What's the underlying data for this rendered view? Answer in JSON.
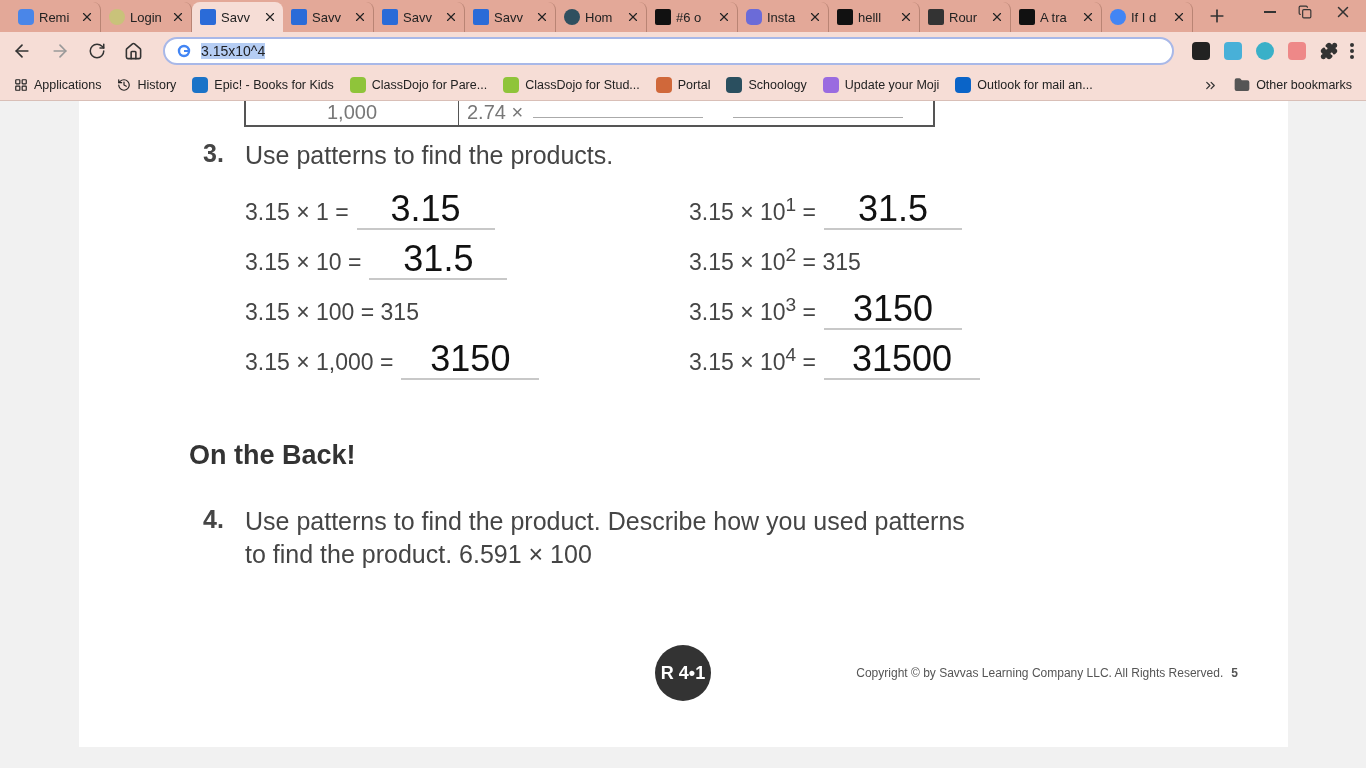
{
  "tabs": [
    {
      "label": "Remi",
      "selected": false
    },
    {
      "label": "Login",
      "selected": false
    },
    {
      "label": "Savv",
      "selected": true
    },
    {
      "label": "Savv",
      "selected": false
    },
    {
      "label": "Savv",
      "selected": false
    },
    {
      "label": "Savv",
      "selected": false
    },
    {
      "label": "Hom",
      "selected": false
    },
    {
      "label": "#6 o",
      "selected": false
    },
    {
      "label": "Insta",
      "selected": false
    },
    {
      "label": "helll",
      "selected": false
    },
    {
      "label": "Rour",
      "selected": false
    },
    {
      "label": "A tra",
      "selected": false
    },
    {
      "label": "If I d",
      "selected": false
    }
  ],
  "address_bar": {
    "value": "3.15x10^4"
  },
  "bookmarks": [
    {
      "label": "Applications",
      "kind": "apps"
    },
    {
      "label": "History",
      "kind": "history"
    },
    {
      "label": "Epic! - Books for Kids",
      "kind": "site"
    },
    {
      "label": "ClassDojo for Pare...",
      "kind": "site"
    },
    {
      "label": "ClassDojo for Stud...",
      "kind": "site"
    },
    {
      "label": "Portal",
      "kind": "site"
    },
    {
      "label": "Schoology",
      "kind": "site"
    },
    {
      "label": "Update your Moji",
      "kind": "site"
    },
    {
      "label": "Outlook for mail an...",
      "kind": "site"
    }
  ],
  "other_bookmarks": "Other bookmarks",
  "document": {
    "table_row": {
      "column_1": "1,000",
      "column_2": "2.74 ×"
    },
    "problem_3": {
      "number": "3.",
      "prompt": "Use patterns to find the products.",
      "left_equations": [
        {
          "kind": "blank",
          "expression": "3.15 × 1 =",
          "answer": "3.15"
        },
        {
          "kind": "blank",
          "expression": "3.15 × 10 =",
          "answer": "31.5"
        },
        {
          "kind": "given",
          "expression": "3.15 × 100 = 315"
        },
        {
          "kind": "blank",
          "expression": "3.15 × 1,000 =",
          "answer": "3150"
        }
      ],
      "right_equations": [
        {
          "kind": "blank",
          "expression": "3.15 × 10$^{1}$ =",
          "answer": "31.5"
        },
        {
          "kind": "given",
          "expression": "3.15 × 10$^{2}$ = 315"
        },
        {
          "kind": "blank",
          "expression": "3.15 × 10$^{3}$ =",
          "answer": "3150"
        },
        {
          "kind": "blank",
          "expression": "3.15 × 10$^{4}$ =",
          "answer": "31500"
        }
      ]
    },
    "section_heading": "On the Back!",
    "problem_4": {
      "number": "4.",
      "prompt": "Use patterns to find the product. Describe how you used patterns to find the product. 6.591 × 100"
    },
    "lesson_badge": "R 4•1",
    "copyright": "Copyright © by Savvas Learning Company LLC. All Rights Reserved.",
    "page_number": "5"
  }
}
